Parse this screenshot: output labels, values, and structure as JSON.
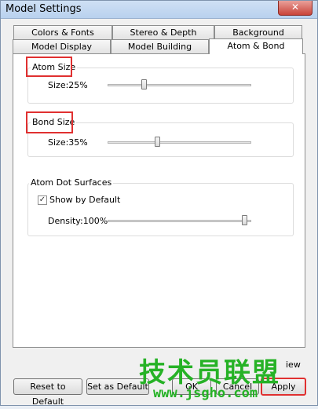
{
  "window": {
    "title": "Model Settings",
    "close_glyph": "✕"
  },
  "tabs_row1": [
    "Colors & Fonts",
    "Stereo & Depth",
    "Background"
  ],
  "tabs_row2": [
    "Model Display",
    "Model Building",
    "Atom & Bond"
  ],
  "active_tab": "Atom & Bond",
  "atom_size": {
    "title": "Atom Size",
    "size_label": "Size:25%",
    "value_percent": 25
  },
  "bond_size": {
    "title": "Bond Size",
    "size_label": "Size:35%",
    "value_percent": 35
  },
  "atom_dot": {
    "title": "Atom Dot Surfaces",
    "show_by_default_label": "Show by Default",
    "show_by_default_checked": true,
    "density_label": "Density:100%",
    "value_percent": 100
  },
  "bottom": {
    "partial_label": "iew",
    "reset_label": "Reset to Default",
    "set_default_label": "Set as Default",
    "ok_label": "OK",
    "cancel_label": "Cancel",
    "apply_label": "Apply"
  },
  "watermark": {
    "text_cn": "技术员联盟",
    "url": "www.jsgho.com"
  },
  "colors": {
    "highlight_red": "#e03030",
    "watermark_green": "#26b226"
  }
}
